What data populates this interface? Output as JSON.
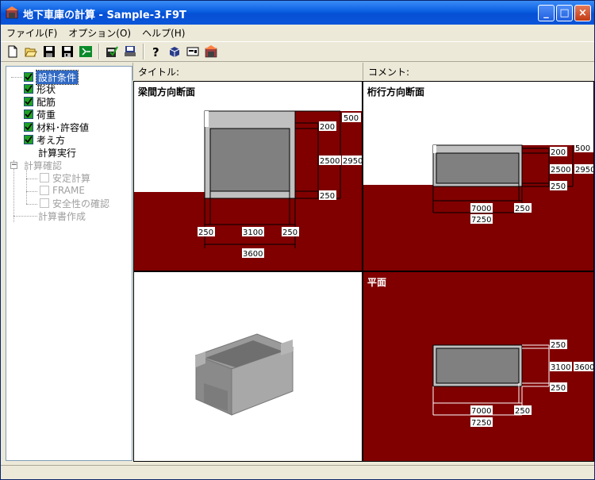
{
  "window": {
    "title": "地下車庫の計算 - Sample-3.F9T"
  },
  "titlebar_buttons": {
    "minimize": "_",
    "maximize": "□",
    "close": "×"
  },
  "menu": {
    "items": [
      "ファイル(F)",
      "オプション(O)",
      "ヘルプ(H)"
    ]
  },
  "toolbar": {
    "icons": [
      "new-file-icon",
      "open-folder-icon",
      "save-icon",
      "save-as-icon",
      "exit-icon",
      "calculate-icon",
      "print-icon",
      "help-icon",
      "model-icon",
      "dialog-icon",
      "building-icon"
    ]
  },
  "tree": {
    "items": [
      {
        "label": "設計条件",
        "checked": true,
        "selected": true,
        "enabled": true
      },
      {
        "label": "形状",
        "checked": true,
        "enabled": true
      },
      {
        "label": "配筋",
        "checked": true,
        "enabled": true
      },
      {
        "label": "荷重",
        "checked": true,
        "enabled": true
      },
      {
        "label": "材料･許容値",
        "checked": true,
        "enabled": true
      },
      {
        "label": "考え方",
        "checked": true,
        "enabled": true
      },
      {
        "label": "計算実行",
        "enabled": true
      },
      {
        "label": "計算確認",
        "enabled": false,
        "expander": "−"
      },
      {
        "label": "安定計算",
        "checked": false,
        "enabled": false
      },
      {
        "label": "FRAME",
        "checked": false,
        "enabled": false
      },
      {
        "label": "安全性の確認",
        "checked": false,
        "enabled": false
      },
      {
        "label": "計算書作成",
        "enabled": false
      }
    ]
  },
  "header": {
    "title_label": "タイトル:",
    "comment_label": "コメント:"
  },
  "panes": {
    "beam_section": {
      "label": "梁間方向断面",
      "dims_right": [
        "500",
        "200",
        "2500",
        "2950",
        "250"
      ],
      "dims_bottom": [
        "250",
        "3100",
        "250",
        "3600"
      ]
    },
    "girder_section": {
      "label": "桁行方向断面",
      "dims_right": [
        "500",
        "200",
        "2500",
        "2950",
        "250"
      ],
      "dims_bottom": [
        "7000",
        "250",
        "7250"
      ]
    },
    "plan": {
      "label": "平面",
      "dims_right": [
        "250",
        "3100",
        "3600",
        "250"
      ],
      "dims_bottom": [
        "7000",
        "250",
        "7250"
      ]
    },
    "view3d": {
      "label": ""
    }
  },
  "colors": {
    "soil": "#800000",
    "concrete": "#808080",
    "wall": "#c0c0c0",
    "window_blue": "#0a5ee0"
  }
}
